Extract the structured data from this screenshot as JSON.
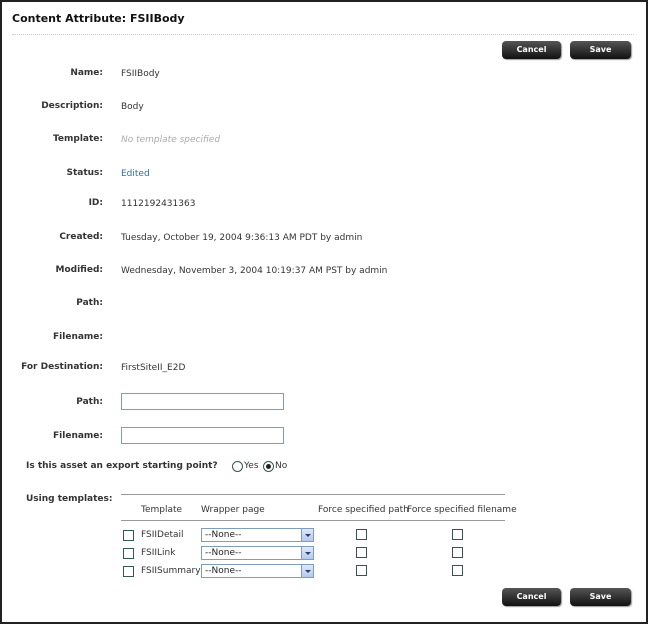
{
  "page": {
    "title": "Content Attribute: FSIIBody",
    "cancel_label": "Cancel",
    "save_label": "Save"
  },
  "fields": [
    {
      "label": "Name:",
      "value": "FSIIBody"
    },
    {
      "label": "Description:",
      "value": "Body"
    },
    {
      "label": "Template:",
      "value": "No template specified"
    },
    {
      "label": "Status:",
      "value": "Edited"
    },
    {
      "label": "ID:",
      "value": "1112192431363"
    },
    {
      "label": "Created:",
      "value": "Tuesday, October 19, 2004 9:36:13 AM PDT by admin"
    },
    {
      "label": "Modified:",
      "value": "Wednesday, November 3, 2004 10:19:37 AM PST by admin"
    },
    {
      "label": "Path:",
      "value": ""
    },
    {
      "label": "Filename:",
      "value": ""
    },
    {
      "label": "For Destination:",
      "value": "FirstSiteII_E2D"
    }
  ],
  "inputs": {
    "path_label": "Path:",
    "path_value": "",
    "filename_label": "Filename:",
    "filename_value": ""
  },
  "export_point": {
    "question": "Is this asset an export starting point?",
    "yes_label": "Yes",
    "no_label": "No",
    "selected": "No"
  },
  "templates": {
    "label": "Using templates:",
    "columns": [
      "Template",
      "Wrapper page",
      "Force specified path",
      "Force specified filename"
    ],
    "rows": [
      {
        "name": "FSIIDetail",
        "wrapper": "--None--"
      },
      {
        "name": "FSIILink",
        "wrapper": "--None--"
      },
      {
        "name": "FSIISummary",
        "wrapper": "--None--"
      }
    ]
  }
}
